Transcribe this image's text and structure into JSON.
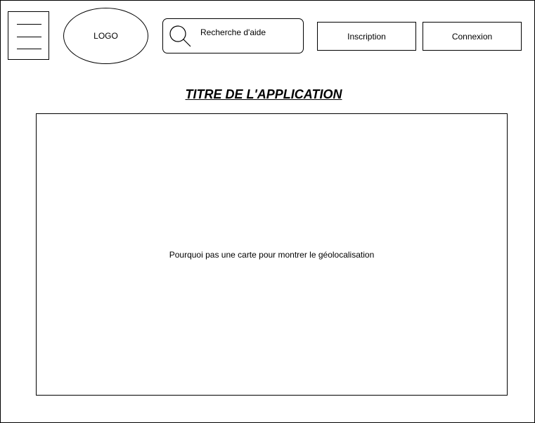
{
  "header": {
    "menu_icon": "hamburger-menu-icon",
    "logo_text": "LOGO",
    "search": {
      "icon": "search-icon",
      "label": "Recherche d'aide"
    },
    "buttons": {
      "inscription": "Inscription",
      "connexion": "Connexion"
    }
  },
  "main": {
    "title": "TITRE DE L'APPLICATION",
    "map_placeholder": "Pourquoi pas une carte pour montrer le géolocalisation"
  }
}
